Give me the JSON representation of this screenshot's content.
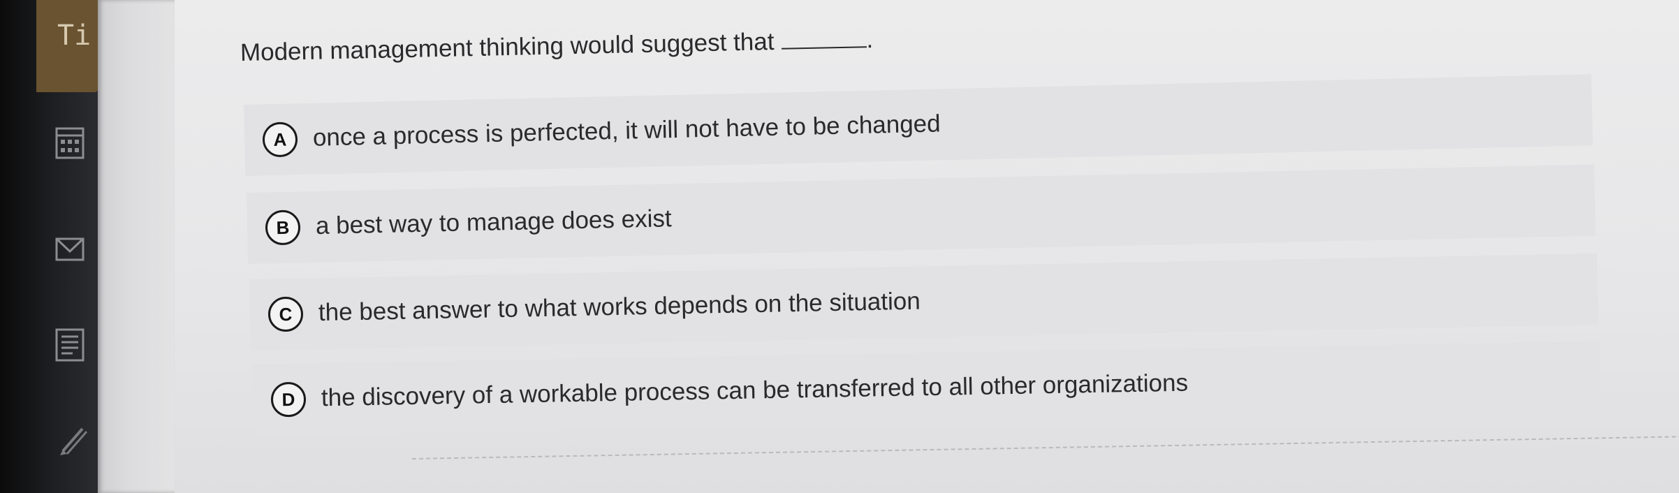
{
  "rail": {
    "tab_label": "Ti",
    "icons": [
      "calendar-icon",
      "mail-icon",
      "document-list-icon",
      "pencil-icon"
    ]
  },
  "question": {
    "text": "Modern management thinking would suggest that",
    "trailing": "."
  },
  "options": [
    {
      "letter": "A",
      "text": "once a process is perfected, it will not have to be changed"
    },
    {
      "letter": "B",
      "text": "a best way to manage does exist"
    },
    {
      "letter": "C",
      "text": "the best answer to what works depends on the situation"
    },
    {
      "letter": "D",
      "text": "the discovery of a workable process can be transferred to all other organizations"
    }
  ]
}
